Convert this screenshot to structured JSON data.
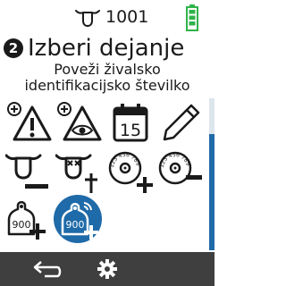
{
  "status": {
    "animal_id": "1001",
    "battery": "full"
  },
  "header": {
    "step": "2",
    "title": "Izberi dejanje",
    "subtitle": "Poveži živalsko identifikacijsko številko"
  },
  "calendar": {
    "day": "15"
  },
  "tags": {
    "tag_number": "900",
    "disc_text": "123 456 789"
  },
  "colors": {
    "accent": "#1f6aa8",
    "battery": "#2fb34a",
    "bar": "#3f3f3f"
  },
  "icons": {
    "back": "back-arrow-icon",
    "settings": "gear-icon"
  }
}
